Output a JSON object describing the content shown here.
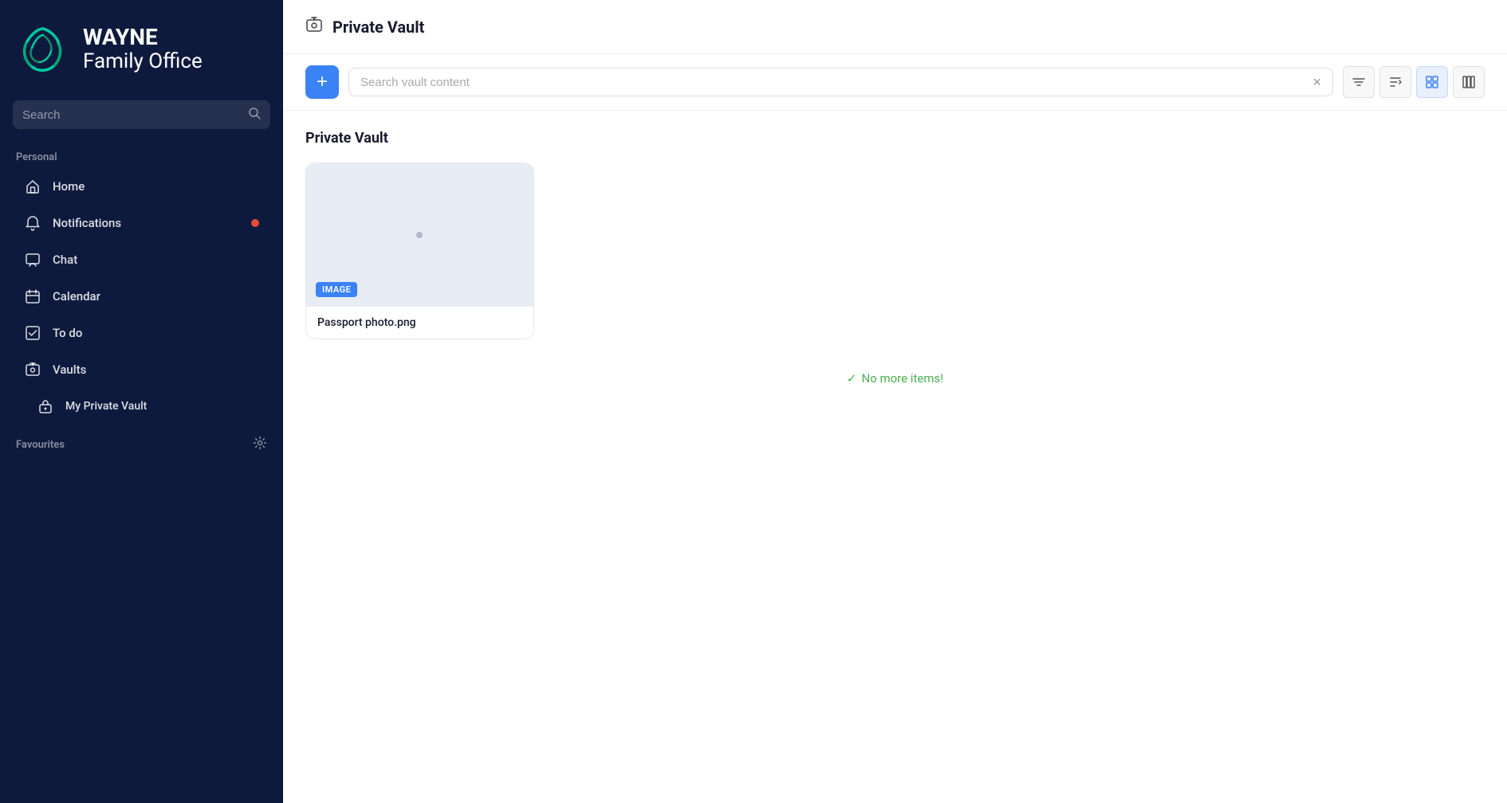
{
  "sidebar": {
    "brand": {
      "line1": "WAYNE",
      "line2": "Family Office"
    },
    "search": {
      "placeholder": "Search"
    },
    "personal_label": "Personal",
    "nav_items": [
      {
        "id": "home",
        "label": "Home",
        "icon": "home"
      },
      {
        "id": "notifications",
        "label": "Notifications",
        "icon": "bell",
        "has_dot": true
      },
      {
        "id": "chat",
        "label": "Chat",
        "icon": "chat"
      },
      {
        "id": "calendar",
        "label": "Calendar",
        "icon": "calendar"
      },
      {
        "id": "todo",
        "label": "To do",
        "icon": "checkbox"
      },
      {
        "id": "vaults",
        "label": "Vaults",
        "icon": "vaults"
      },
      {
        "id": "my-private-vault",
        "label": "My Private Vault",
        "icon": "vault-lock",
        "sub": true
      }
    ],
    "favourites_label": "Favourites"
  },
  "main": {
    "header": {
      "icon": "vault",
      "title": "Private Vault"
    },
    "toolbar": {
      "add_label": "+",
      "search_placeholder": "Search vault content",
      "clear_label": "×"
    },
    "view_controls": [
      {
        "id": "filter",
        "icon": "filter"
      },
      {
        "id": "sort",
        "icon": "sort"
      },
      {
        "id": "grid",
        "icon": "grid"
      },
      {
        "id": "columns",
        "icon": "columns"
      }
    ],
    "section_title": "Private Vault",
    "items": [
      {
        "id": "passport-photo",
        "type_badge": "IMAGE",
        "filename": "Passport photo.png"
      }
    ],
    "no_more_label": "No more items!"
  }
}
